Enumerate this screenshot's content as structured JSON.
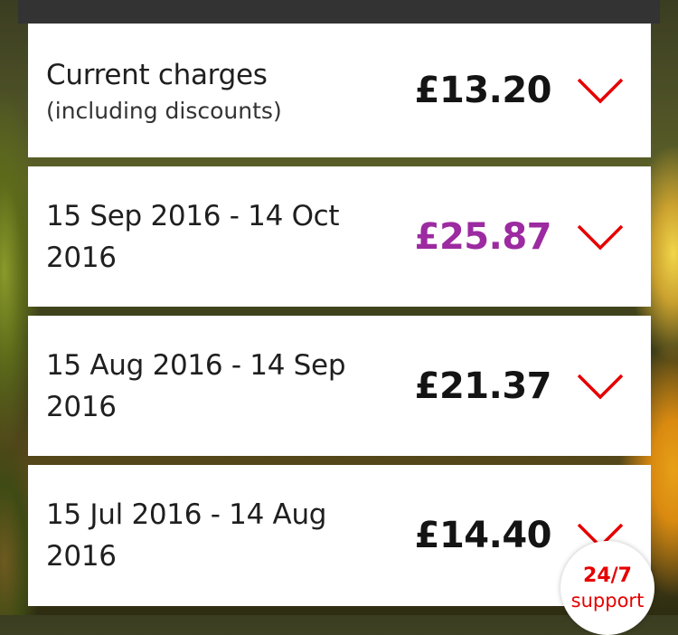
{
  "current": {
    "label": "Current charges",
    "sublabel": "(including discounts)",
    "amount": "£13.20"
  },
  "bills": [
    {
      "date_line1": "15 Sep 2016 - 14 Oct",
      "date_line2": "2016",
      "amount": "£25.87"
    },
    {
      "date_line1": "15 Aug 2016 - 14 Sep",
      "date_line2": "2016",
      "amount": "£21.37"
    },
    {
      "date_line1": "15 Jul 2016 - 14 Aug",
      "date_line2": "2016",
      "amount": "£14.40"
    }
  ],
  "support": {
    "hours": "24/7",
    "label": "support"
  },
  "colors": {
    "accent_red": "#e60000",
    "highlight_amount": "#9c2aa0",
    "header_bar": "#333333"
  },
  "icons": {
    "expand": "chevron-down-icon"
  }
}
